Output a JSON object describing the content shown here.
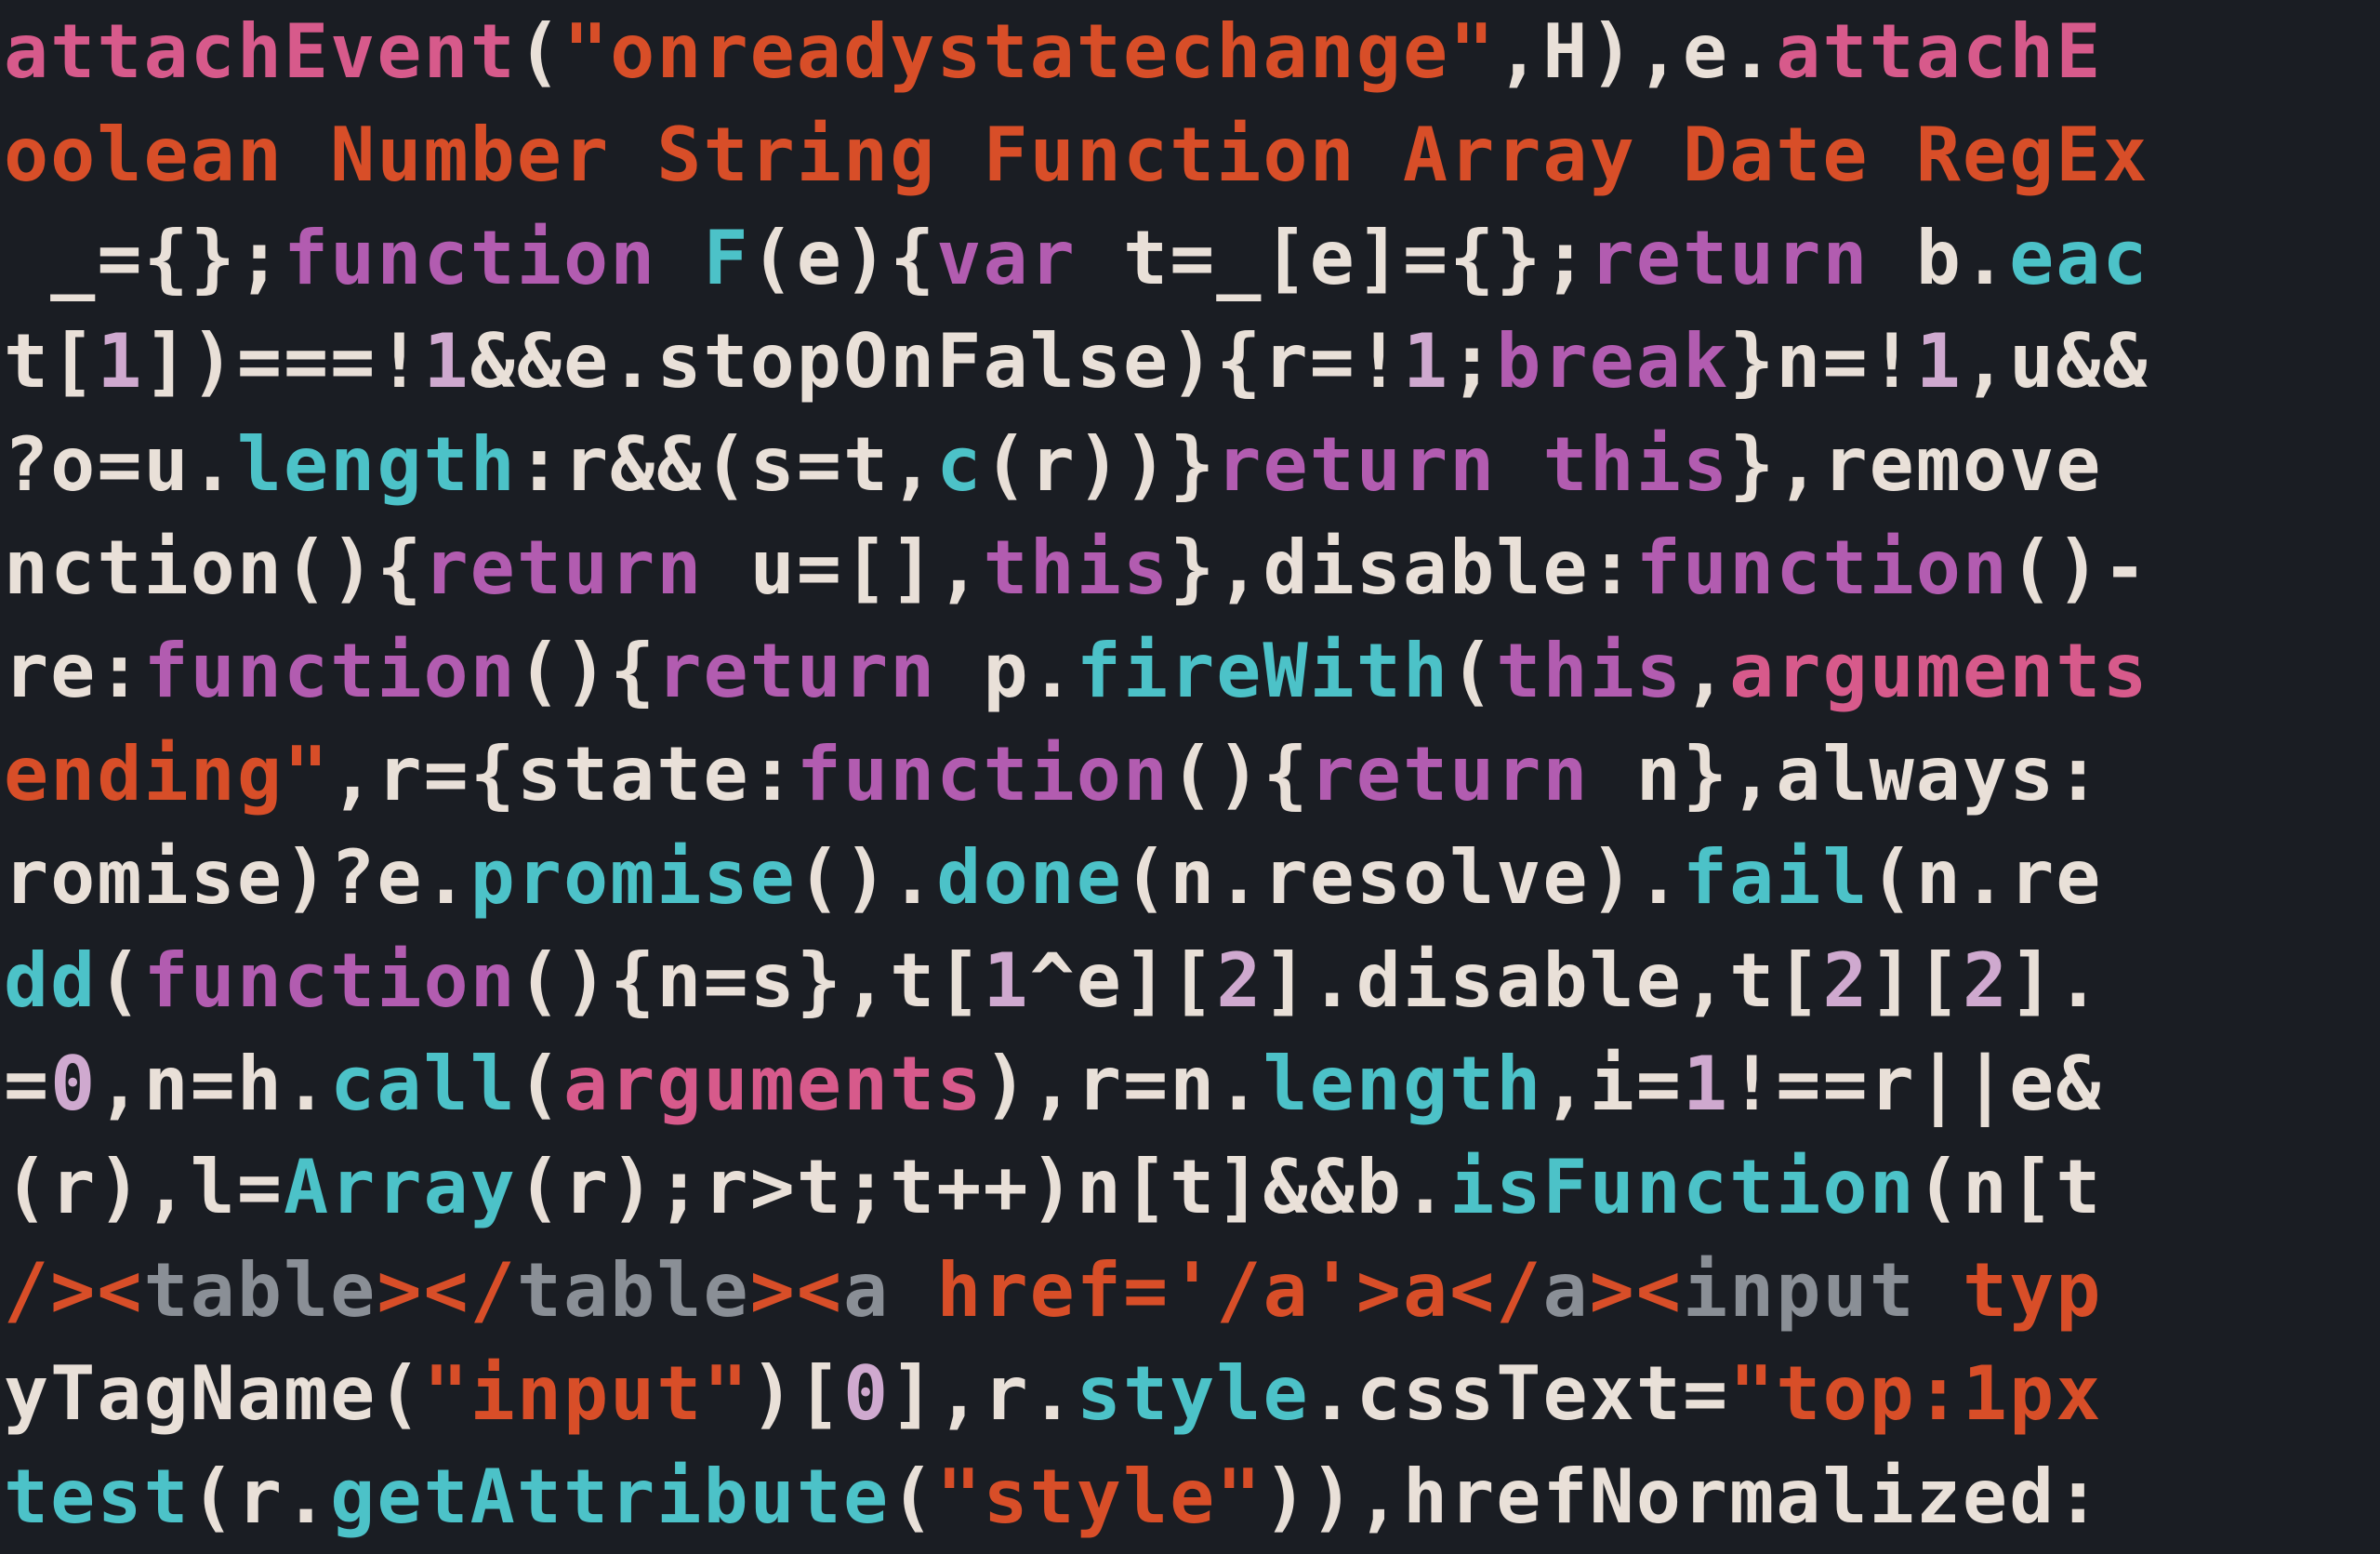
{
  "code_lines": [
    {
      "tokens": [
        {
          "c": "pk",
          "t": "attachEvent"
        },
        {
          "c": "wh",
          "t": "("
        },
        {
          "c": "or",
          "t": "\"onreadystatechange\""
        },
        {
          "c": "wh",
          "t": ",H),e."
        },
        {
          "c": "pk",
          "t": "attachE"
        }
      ]
    },
    {
      "tokens": [
        {
          "c": "or",
          "t": "oolean Number String Function Array Date RegEx"
        }
      ]
    },
    {
      "tokens": [
        {
          "c": "wh",
          "t": " _={};"
        },
        {
          "c": "pu",
          "t": "function"
        },
        {
          "c": "wh",
          "t": " "
        },
        {
          "c": "cy",
          "t": "F"
        },
        {
          "c": "wh",
          "t": "(e){"
        },
        {
          "c": "pu",
          "t": "var"
        },
        {
          "c": "wh",
          "t": " t=_[e]={};"
        },
        {
          "c": "pu",
          "t": "return"
        },
        {
          "c": "wh",
          "t": " b."
        },
        {
          "c": "cy",
          "t": "eac"
        }
      ]
    },
    {
      "tokens": [
        {
          "c": "wh",
          "t": "t["
        },
        {
          "c": "pw",
          "t": "1"
        },
        {
          "c": "wh",
          "t": "])===!"
        },
        {
          "c": "pw",
          "t": "1"
        },
        {
          "c": "wh",
          "t": "&&e.stopOnFalse){r=!"
        },
        {
          "c": "pw",
          "t": "1"
        },
        {
          "c": "wh",
          "t": ";"
        },
        {
          "c": "pu",
          "t": "break"
        },
        {
          "c": "wh",
          "t": "}n=!"
        },
        {
          "c": "pw",
          "t": "1"
        },
        {
          "c": "wh",
          "t": ",u&&"
        }
      ]
    },
    {
      "tokens": [
        {
          "c": "wh",
          "t": "?o=u."
        },
        {
          "c": "cy",
          "t": "length"
        },
        {
          "c": "wh",
          "t": ":r&&(s=t,"
        },
        {
          "c": "cy",
          "t": "c"
        },
        {
          "c": "wh",
          "t": "(r))}"
        },
        {
          "c": "pu",
          "t": "return"
        },
        {
          "c": "wh",
          "t": " "
        },
        {
          "c": "pu",
          "t": "this"
        },
        {
          "c": "wh",
          "t": "},remove"
        }
      ]
    },
    {
      "tokens": [
        {
          "c": "wh",
          "t": "nction(){"
        },
        {
          "c": "pu",
          "t": "return"
        },
        {
          "c": "wh",
          "t": " u=[],"
        },
        {
          "c": "pu",
          "t": "this"
        },
        {
          "c": "wh",
          "t": "},disable:"
        },
        {
          "c": "pu",
          "t": "function"
        },
        {
          "c": "wh",
          "t": "()-"
        }
      ]
    },
    {
      "tokens": [
        {
          "c": "wh",
          "t": "re:"
        },
        {
          "c": "pu",
          "t": "function"
        },
        {
          "c": "wh",
          "t": "(){"
        },
        {
          "c": "pu",
          "t": "return"
        },
        {
          "c": "wh",
          "t": " p."
        },
        {
          "c": "cy",
          "t": "fireWith"
        },
        {
          "c": "wh",
          "t": "("
        },
        {
          "c": "pu",
          "t": "this"
        },
        {
          "c": "wh",
          "t": ","
        },
        {
          "c": "pk",
          "t": "arguments"
        }
      ]
    },
    {
      "tokens": [
        {
          "c": "or",
          "t": "ending\""
        },
        {
          "c": "wh",
          "t": ",r={state:"
        },
        {
          "c": "pu",
          "t": "function"
        },
        {
          "c": "wh",
          "t": "(){"
        },
        {
          "c": "pu",
          "t": "return"
        },
        {
          "c": "wh",
          "t": " n},always:"
        }
      ]
    },
    {
      "tokens": [
        {
          "c": "wh",
          "t": "romise)?e."
        },
        {
          "c": "cy",
          "t": "promise"
        },
        {
          "c": "wh",
          "t": "()."
        },
        {
          "c": "cy",
          "t": "done"
        },
        {
          "c": "wh",
          "t": "(n.resolve)."
        },
        {
          "c": "cy",
          "t": "fail"
        },
        {
          "c": "wh",
          "t": "(n.re"
        }
      ]
    },
    {
      "tokens": [
        {
          "c": "cy",
          "t": "dd"
        },
        {
          "c": "wh",
          "t": "("
        },
        {
          "c": "pu",
          "t": "function"
        },
        {
          "c": "wh",
          "t": "(){n=s},t["
        },
        {
          "c": "pw",
          "t": "1"
        },
        {
          "c": "wh",
          "t": "^e]["
        },
        {
          "c": "pw",
          "t": "2"
        },
        {
          "c": "wh",
          "t": "].disable,t["
        },
        {
          "c": "pw",
          "t": "2"
        },
        {
          "c": "wh",
          "t": "]["
        },
        {
          "c": "pw",
          "t": "2"
        },
        {
          "c": "wh",
          "t": "]."
        }
      ]
    },
    {
      "tokens": [
        {
          "c": "wh",
          "t": "="
        },
        {
          "c": "pw",
          "t": "0"
        },
        {
          "c": "wh",
          "t": ",n=h."
        },
        {
          "c": "cy",
          "t": "call"
        },
        {
          "c": "wh",
          "t": "("
        },
        {
          "c": "pk",
          "t": "arguments"
        },
        {
          "c": "wh",
          "t": "),r=n."
        },
        {
          "c": "cy",
          "t": "length"
        },
        {
          "c": "wh",
          "t": ",i="
        },
        {
          "c": "pw",
          "t": "1"
        },
        {
          "c": "wh",
          "t": "!==r||e&"
        }
      ]
    },
    {
      "tokens": [
        {
          "c": "wh",
          "t": "(r),l="
        },
        {
          "c": "cy",
          "t": "Array"
        },
        {
          "c": "wh",
          "t": "(r);r>t;t++)n[t]&&b."
        },
        {
          "c": "cy",
          "t": "isFunction"
        },
        {
          "c": "wh",
          "t": "(n[t"
        }
      ]
    },
    {
      "tokens": [
        {
          "c": "or",
          "t": "/><"
        },
        {
          "c": "gr",
          "t": "table"
        },
        {
          "c": "or",
          "t": "></"
        },
        {
          "c": "gr",
          "t": "table"
        },
        {
          "c": "or",
          "t": "><"
        },
        {
          "c": "gr",
          "t": "a"
        },
        {
          "c": "or",
          "t": " href='/a'>a</"
        },
        {
          "c": "gr",
          "t": "a"
        },
        {
          "c": "or",
          "t": "><"
        },
        {
          "c": "gr",
          "t": "input"
        },
        {
          "c": "or",
          "t": " typ"
        }
      ]
    },
    {
      "tokens": [
        {
          "c": "wh",
          "t": "yTagName("
        },
        {
          "c": "or",
          "t": "\"input\""
        },
        {
          "c": "wh",
          "t": ")["
        },
        {
          "c": "pw",
          "t": "0"
        },
        {
          "c": "wh",
          "t": "],r."
        },
        {
          "c": "cy",
          "t": "style"
        },
        {
          "c": "wh",
          "t": ".cssText="
        },
        {
          "c": "or",
          "t": "\"top:1px"
        }
      ]
    },
    {
      "tokens": [
        {
          "c": "cy",
          "t": "test"
        },
        {
          "c": "wh",
          "t": "(r."
        },
        {
          "c": "cy",
          "t": "getAttribute"
        },
        {
          "c": "wh",
          "t": "("
        },
        {
          "c": "or",
          "t": "\"style\""
        },
        {
          "c": "wh",
          "t": ")),hrefNormalized:"
        }
      ]
    }
  ]
}
